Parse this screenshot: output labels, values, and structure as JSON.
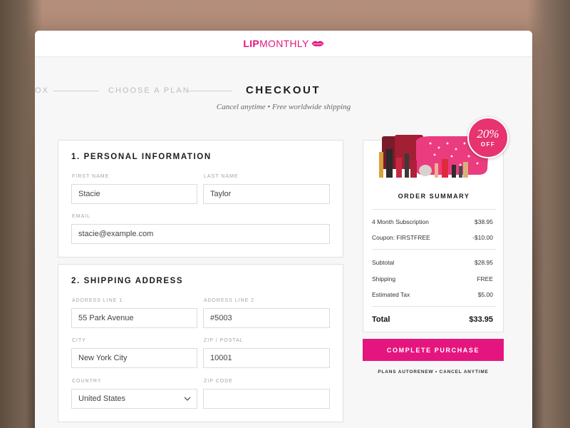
{
  "brand": {
    "lip": "LIP",
    "monthly": "MONTHLY",
    "accent": "#e5157f"
  },
  "steps": {
    "prev2": "OX",
    "prev1": "CHOOSE A PLAN",
    "current": "CHECKOUT"
  },
  "tagline": "Cancel anytime • Free worldwide shipping",
  "personal": {
    "title": "1. PERSONAL INFORMATION",
    "first_name_label": "FIRST NAME",
    "first_name_value": "Stacie",
    "last_name_label": "LAST NAME",
    "last_name_value": "Taylor",
    "email_label": "EMAIL",
    "email_value": "stacie@example.com"
  },
  "shipping": {
    "title": "2. SHIPPING ADDRESS",
    "address1_label": "ADDRESS LINE 1",
    "address1_value": "55 Park Avenue",
    "address2_label": "ADDRESS LINE 2",
    "address2_value": "#5003",
    "city_label": "CITY",
    "city_value": "New York City",
    "zip_postal_label": "ZIP / POSTAL",
    "zip_postal_value": "10001",
    "country_label": "COUNTRY",
    "country_value": "United States",
    "zip_code_label": "ZIP CODE",
    "zip_code_value": ""
  },
  "badge": {
    "percent": "20%",
    "off": "OFF"
  },
  "summary": {
    "title": "ORDER SUMMARY",
    "rows1": [
      {
        "label": "4 Month Subscription",
        "value": "$38.95"
      },
      {
        "label": "Coupon: FIRSTFREE",
        "value": "-$10.00"
      }
    ],
    "rows2": [
      {
        "label": "Subtotal",
        "value": "$28.95"
      },
      {
        "label": "Shipping",
        "value": "FREE"
      },
      {
        "label": "Estimated Tax",
        "value": "$5.00"
      }
    ],
    "total_label": "Total",
    "total_value": "$33.95"
  },
  "purchase_label": "COMPLETE PURCHASE",
  "footnote": "PLANS AUTORENEW  •  CANCEL ANYTIME"
}
